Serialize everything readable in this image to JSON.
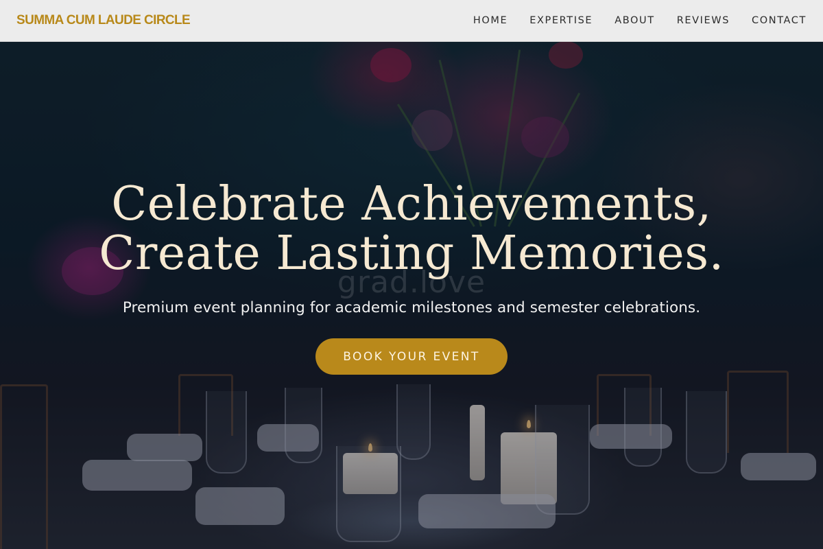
{
  "header": {
    "brand": "SUMMA CUM LAUDE CIRCLE",
    "nav": [
      "HOME",
      "EXPERTISE",
      "ABOUT",
      "REVIEWS",
      "CONTACT"
    ]
  },
  "hero": {
    "title_line1": "Celebrate Achievements,",
    "title_line2": "Create Lasting Memories.",
    "watermark": "grad.love",
    "subtitle": "Premium event planning for academic milestones and semester celebrations.",
    "cta_label": "BOOK YOUR EVENT"
  },
  "colors": {
    "accent": "#b9891b",
    "brand_text": "#b8891a",
    "header_bg": "#ececec",
    "title_text": "#f6e9d2"
  }
}
